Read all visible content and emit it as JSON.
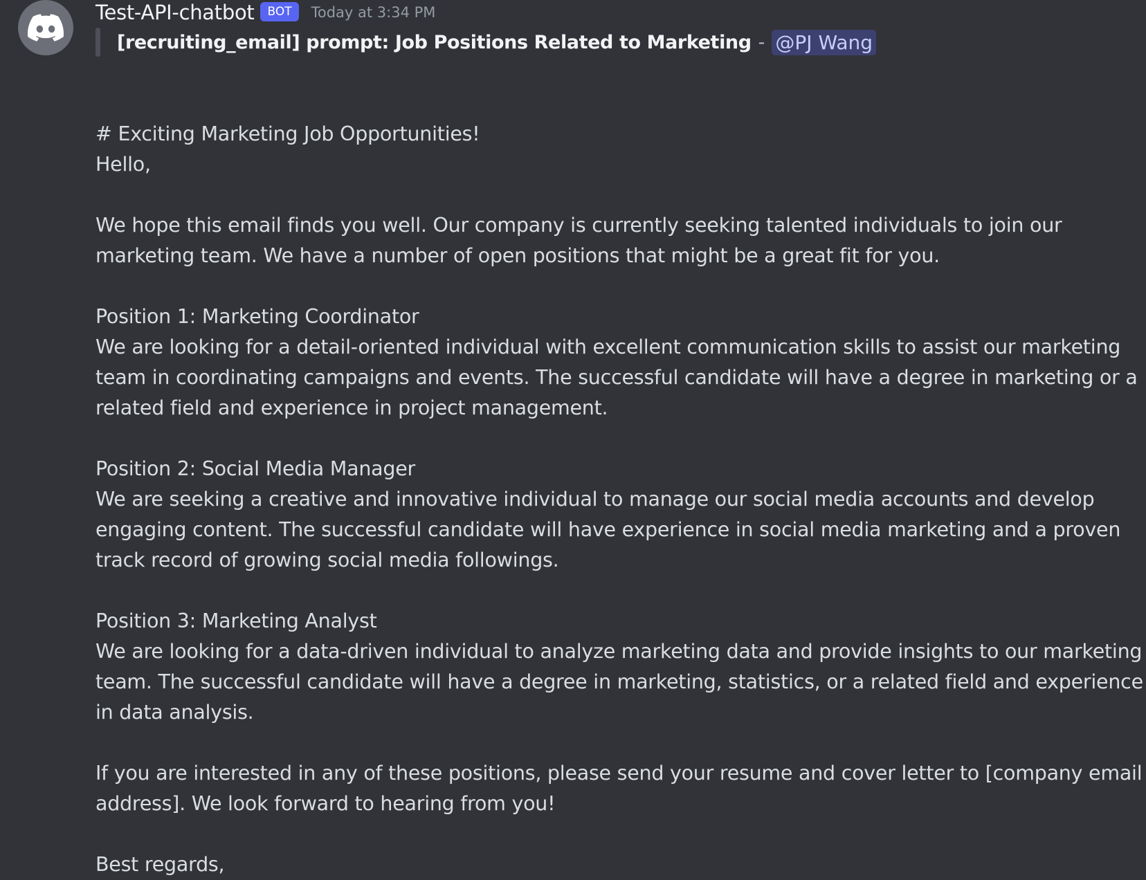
{
  "message": {
    "username": "Test-API-chatbot",
    "badge": "BOT",
    "timestamp": "Today at 3:34 PM",
    "avatar_icon": "discord-logo-icon",
    "reply": {
      "title": "[recruiting_email] prompt: Job Positions Related to Marketing",
      "separator": "-",
      "mention": "@PJ Wang"
    },
    "lines": [
      "# Exciting Marketing Job Opportunities!",
      "Hello,",
      "",
      "We hope this email finds you well. Our company is currently seeking talented individuals to join our",
      "marketing team. We have a number of open positions that might be a great fit for you.",
      "",
      "Position 1: Marketing Coordinator",
      "We are looking for a detail-oriented individual with excellent communication skills to assist our marketing",
      "team in coordinating campaigns and events. The successful candidate will have a degree in marketing or a",
      "related field and experience in project management.",
      "",
      "Position 2: Social Media Manager",
      "We are seeking a creative and innovative individual to manage our social media accounts and develop",
      "engaging content. The successful candidate will have experience in social media marketing and a proven",
      "track record of growing social media followings.",
      "",
      "Position 3: Marketing Analyst",
      "We are looking for a data-driven individual to analyze marketing data and provide insights to our marketing",
      "team. The successful candidate will have a degree in marketing, statistics, or a related field and experience",
      "in data analysis.",
      "",
      "If you are interested in any of these positions, please send your resume and cover letter to [company email",
      "address]. We look forward to hearing from you!",
      "",
      "Best regards,"
    ]
  },
  "colors": {
    "background": "#313338",
    "badge": "#5865f2",
    "mention_text": "#c9cdfb",
    "timestamp": "#949ba4"
  }
}
